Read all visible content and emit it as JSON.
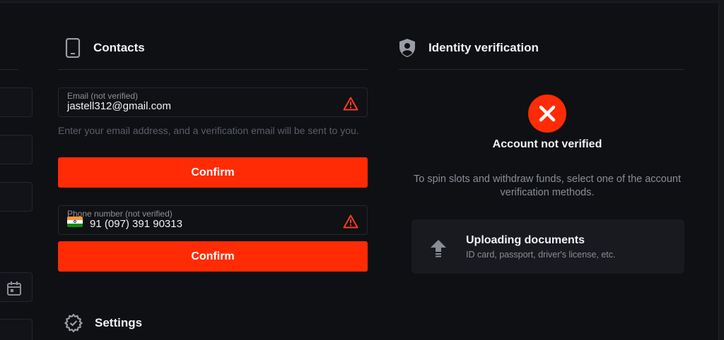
{
  "contacts": {
    "title": "Contacts",
    "email": {
      "label": "Email (not verified)",
      "value": "jastell312@gmail.com",
      "hint": "Enter your email address, and a verification email will be sent to you."
    },
    "confirm_label": "Confirm",
    "phone": {
      "label": "Phone number (not verified)",
      "value": "91 (097) 391 90313",
      "flag": "india-flag-icon"
    },
    "confirm_phone_label": "Confirm"
  },
  "settings": {
    "title": "Settings"
  },
  "identity": {
    "title": "Identity verification",
    "status": "Account not verified",
    "description": "To spin slots and withdraw funds, select one of the account verification methods.",
    "methods": [
      {
        "title": "Uploading documents",
        "subtitle": "ID card, passport, driver's license, etc.",
        "icon": "upload-icon"
      }
    ]
  },
  "colors": {
    "accent": "#ff2b04",
    "background": "#0e1014",
    "warning": "#ff3b1f"
  }
}
